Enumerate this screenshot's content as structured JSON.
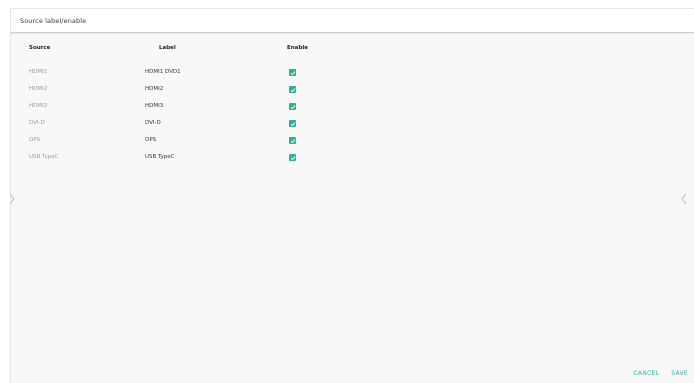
{
  "dialog": {
    "title": "Source label/enable"
  },
  "table": {
    "headers": {
      "source": "Source",
      "label": "Label",
      "enable": "Enable"
    },
    "rows": [
      {
        "source": "HDMI1",
        "label": "HDMI1 DVD1",
        "enabled": true
      },
      {
        "source": "HDMI2",
        "label": "HDMI2",
        "enabled": true
      },
      {
        "source": "HDMI3",
        "label": "HDMI3",
        "enabled": true
      },
      {
        "source": "DVI-D",
        "label": "DVI-D",
        "enabled": true
      },
      {
        "source": "OPS",
        "label": "OPS",
        "enabled": true
      },
      {
        "source": "USB TypeC",
        "label": "USB TypeC",
        "enabled": true
      }
    ]
  },
  "footer": {
    "cancel_label": "CANCEL",
    "save_label": "SAVE"
  },
  "colors": {
    "accent": "#2bb3a6",
    "checkbox": "#2eaf9a",
    "source_text": "#9a9a9a",
    "background": "#f8f8f8"
  },
  "icons": {
    "left_nav": "chevron-left-icon",
    "right_nav": "chevron-right-icon",
    "checkbox": "checkmark-icon"
  }
}
